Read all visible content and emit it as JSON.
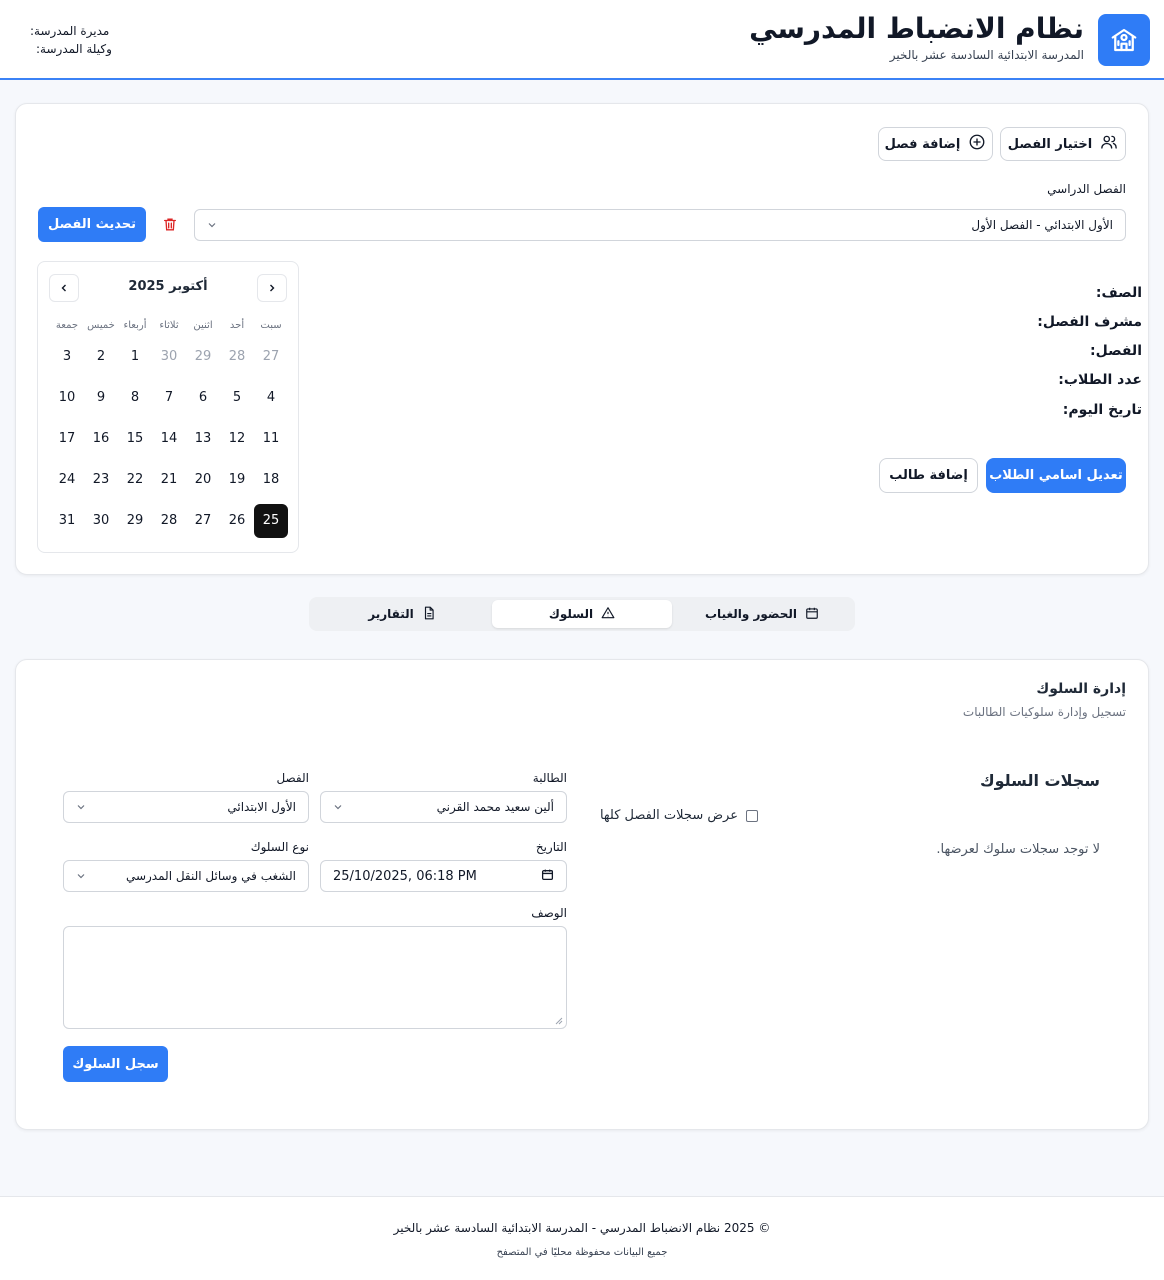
{
  "header": {
    "title": "نظام الانضباط المدرسي",
    "subtitle": "المدرسة الابتدائية السادسة عشر بالخير",
    "principal_label": "مديرة المدرسة:",
    "vice_label": "وكيلة المدرسة:",
    "logo_icon": "school-icon",
    "accent": "#2f7cf6"
  },
  "class_card": {
    "select_class_label": "اختيار الفصل",
    "add_class_label": "إضافة فصل",
    "term_label": "الفصل الدراسي",
    "term_value": "الأول الابتدائي - الفصل الأول",
    "update_label": "تحديث الفصل",
    "info": {
      "grade": "الصف:",
      "supervisor": "مشرف الفصل:",
      "class": "الفصل:",
      "students_count": "عدد الطلاب:",
      "today": "تاريخ اليوم:"
    },
    "edit_students_label": "تعديل اسامي الطلاب",
    "add_student_label": "إضافة طالب"
  },
  "calendar": {
    "title": "أكتوبر 2025",
    "weekdays": [
      "سبت",
      "أحد",
      "اثنين",
      "ثلاثاء",
      "أربعاء",
      "خميس",
      "جمعة"
    ],
    "weeks": [
      [
        "27",
        "28",
        "29",
        "30",
        "1",
        "2",
        "3"
      ],
      [
        "4",
        "5",
        "6",
        "7",
        "8",
        "9",
        "10"
      ],
      [
        "11",
        "12",
        "13",
        "14",
        "15",
        "16",
        "17"
      ],
      [
        "18",
        "19",
        "20",
        "21",
        "22",
        "23",
        "24"
      ],
      [
        "25",
        "26",
        "27",
        "28",
        "29",
        "30",
        "31"
      ]
    ],
    "outside_days": [
      "27",
      "28",
      "29",
      "30"
    ],
    "selected": "25"
  },
  "tabs": [
    {
      "label": "الحضور والغياب",
      "icon": "calendar-icon"
    },
    {
      "label": "السلوك",
      "icon": "warning-icon",
      "active": true
    },
    {
      "label": "التقارير",
      "icon": "file-icon"
    }
  ],
  "behavior": {
    "title": "إدارة السلوك",
    "subtitle": "تسجيل وإدارة سلوكيات الطالبات",
    "records_title": "سجلات السلوك",
    "show_all_label": "عرض سجلات الفصل كلها",
    "empty_text": "لا توجد سجلات سلوك لعرضها.",
    "student_label": "الطالبة",
    "student_value": "ألين سعيد محمد القرني",
    "class_label": "الفصل",
    "class_value": "الأول الابتدائي",
    "date_label": "التاريخ",
    "date_value": "25/10/2025, 06:18 PM",
    "type_label": "نوع السلوك",
    "type_value": "الشغب في وسائل النقل المدرسي",
    "desc_label": "الوصف",
    "submit_label": "سجل السلوك"
  },
  "footer": {
    "copyright": "© 2025 نظام الانضباط المدرسي - المدرسة الابتدائية السادسة عشر بالخير",
    "note": "جميع البيانات محفوظة محليًا في المتصفح"
  }
}
